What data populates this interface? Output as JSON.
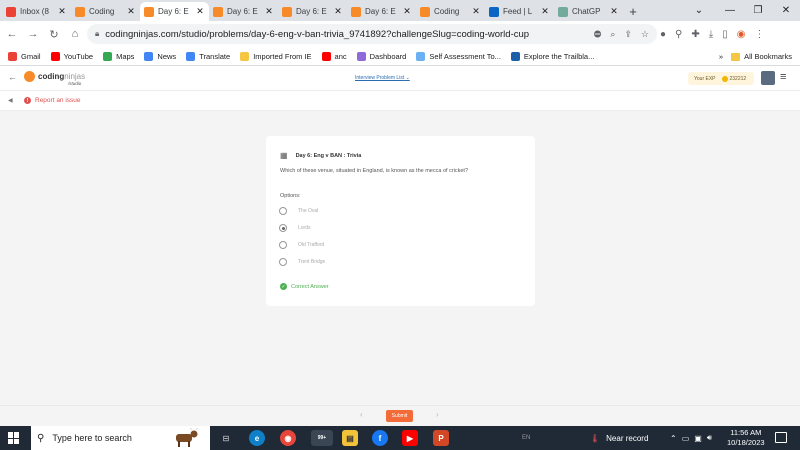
{
  "browser": {
    "tabs": [
      {
        "label": "Inbox (8",
        "favicon": "gmail-icon",
        "color": "#ea4335",
        "active": false
      },
      {
        "label": "Coding",
        "favicon": "codingninjas-icon",
        "color": "#f78b2a",
        "active": false
      },
      {
        "label": "Day 6: E",
        "favicon": "codingninjas-icon",
        "color": "#f78b2a",
        "active": true
      },
      {
        "label": "Day 6: E",
        "favicon": "codingninjas-icon",
        "color": "#f78b2a",
        "active": false
      },
      {
        "label": "Day 6: E",
        "favicon": "codingninjas-icon",
        "color": "#f78b2a",
        "active": false
      },
      {
        "label": "Day 6: E",
        "favicon": "codingninjas-icon",
        "color": "#f78b2a",
        "active": false
      },
      {
        "label": "Coding",
        "favicon": "codingninjas-icon",
        "color": "#f78b2a",
        "active": false
      },
      {
        "label": "Feed | L",
        "favicon": "linkedin-icon",
        "color": "#0a66c2",
        "active": false
      },
      {
        "label": "ChatGP",
        "favicon": "chatgpt-icon",
        "color": "#74aa9c",
        "active": false
      }
    ],
    "new_tab": "+",
    "url": "codingninjas.com/studio/problems/day-6-eng-v-ban-trivia_9741892?challengeSlug=coding-world-cup",
    "bookmarks": [
      {
        "label": "Gmail",
        "color": "#ea4335"
      },
      {
        "label": "YouTube",
        "color": "#ff0000"
      },
      {
        "label": "Maps",
        "color": "#34a853"
      },
      {
        "label": "News",
        "color": "#4285f4"
      },
      {
        "label": "Translate",
        "color": "#4285f4"
      },
      {
        "label": "Imported From IE",
        "color": "#f6c542"
      },
      {
        "label": "anc",
        "color": "#ff0000"
      },
      {
        "label": "Dashboard",
        "color": "#8e6bd8"
      },
      {
        "label": "Self Assessment To...",
        "color": "#6ab0f3"
      },
      {
        "label": "Explore the Trailbla...",
        "color": "#1b5fa8"
      }
    ],
    "bookmarks_more": "»",
    "all_bookmarks": "All Bookmarks"
  },
  "site": {
    "logo_main": "coding",
    "logo_accent": "ninjas",
    "logo_sub": "/studio",
    "nav_link": "Interview Problem List",
    "exp_label": "Your EXP",
    "exp_value": "232212",
    "report_issue": "Report an issue"
  },
  "question": {
    "title": "Day 6: Eng v BAN : Trivia",
    "text": "Which of these venue, situated in England, is known as the mecca of cricket?",
    "options_label": "Options:",
    "options": [
      {
        "label": "The Oval",
        "selected": false
      },
      {
        "label": "Lords",
        "selected": true
      },
      {
        "label": "Old Trafford",
        "selected": false
      },
      {
        "label": "Trent Bridge",
        "selected": false
      }
    ],
    "result": "Correct Answer"
  },
  "footer": {
    "prev": "‹",
    "submit": "Submit",
    "next": "›"
  },
  "taskbar": {
    "search_placeholder": "Type here to search",
    "badge": "99+",
    "language": "EN",
    "near_record": "Near record",
    "time": "11:56 AM",
    "date": "10/18/2023"
  }
}
